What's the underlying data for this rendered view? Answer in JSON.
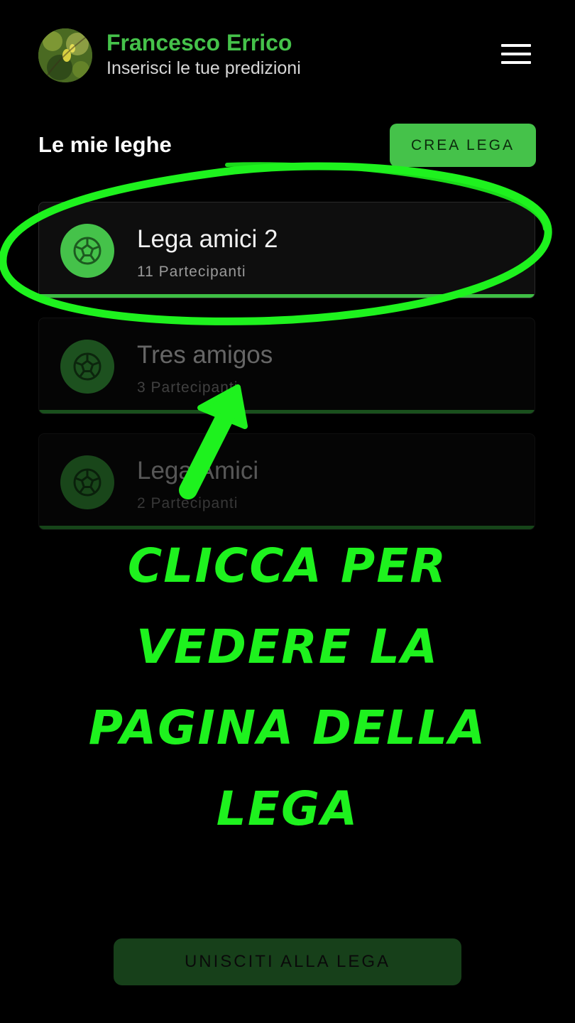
{
  "header": {
    "user_name": "Francesco Errico",
    "subtitle": "Inserisci le tue predizioni",
    "avatar_icon": "lemon-tree-photo"
  },
  "leagues_section": {
    "title": "Le mie leghe",
    "create_label": "CREA LEGA",
    "items": [
      {
        "name": "Lega amici 2",
        "participants": "11 Partecipanti",
        "icon": "soccer-ball-icon"
      },
      {
        "name": "Tres amigos",
        "participants": "3 Partecipanti",
        "icon": "soccer-ball-icon"
      },
      {
        "name": "Lega Amici",
        "participants": "2 Partecipanti",
        "icon": "soccer-ball-icon"
      }
    ]
  },
  "annotation": {
    "text": "Clicca per vedere la pagina della lega",
    "color": "#1ef21e"
  },
  "footer": {
    "join_label": "UNISCITI ALLA LEGA"
  },
  "colors": {
    "accent": "#45c24a",
    "background": "#000000",
    "card": "#0e0e0e"
  }
}
